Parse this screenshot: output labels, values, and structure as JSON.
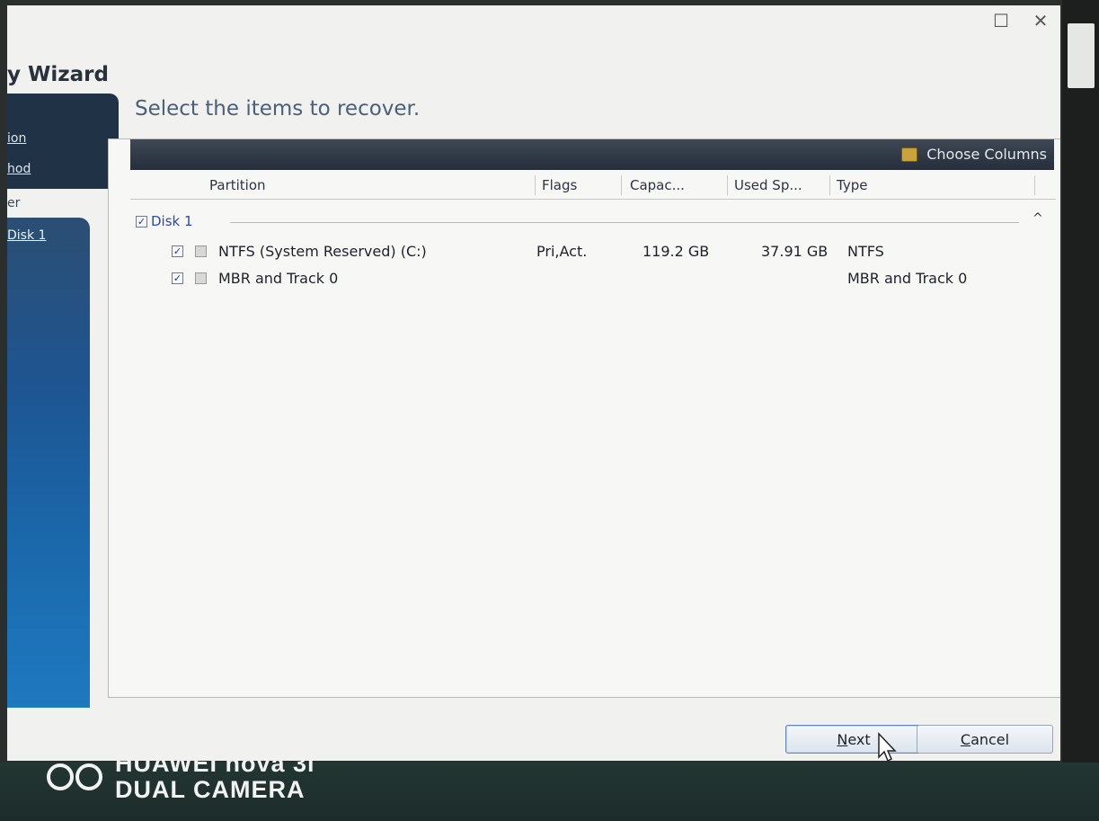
{
  "window": {
    "title": "y Wizard",
    "maximize_glyph": "☐",
    "close_glyph": "✕"
  },
  "sidebar": {
    "items": [
      {
        "label": "ion"
      },
      {
        "label": "hod"
      },
      {
        "label": "er"
      },
      {
        "label": "Disk 1"
      }
    ]
  },
  "main": {
    "heading": "Select the items to recover.",
    "toolbar": {
      "choose_columns": "Choose Columns",
      "icon": "choose-columns-icon"
    },
    "columns": [
      "Partition",
      "Flags",
      "Capac...",
      "Used Sp...",
      "Type"
    ],
    "group": {
      "label": "Disk 1",
      "checked": true,
      "collapse_glyph": "^"
    },
    "rows": [
      {
        "name": "NTFS (System Reserved) (C:)",
        "flags": "Pri,Act.",
        "capacity": "119.2 GB",
        "used": "37.91 GB",
        "type": "NTFS",
        "checked": true
      },
      {
        "name": "MBR and Track 0",
        "flags": "",
        "capacity": "",
        "used": "",
        "type": "MBR and Track 0",
        "checked": true
      }
    ]
  },
  "buttons": {
    "next": {
      "mnemonic": "N",
      "rest": "ext"
    },
    "cancel": {
      "mnemonic": "C",
      "rest": "ancel"
    }
  },
  "watermark": {
    "line1": "HUAWEI nova 3i",
    "line2": "DUAL CAMERA"
  },
  "colors": {
    "sidebar_top": "#203246",
    "sidebar_bottom": "#1f79bf",
    "toolbar": "#2f3844",
    "heading": "#4a6078"
  }
}
